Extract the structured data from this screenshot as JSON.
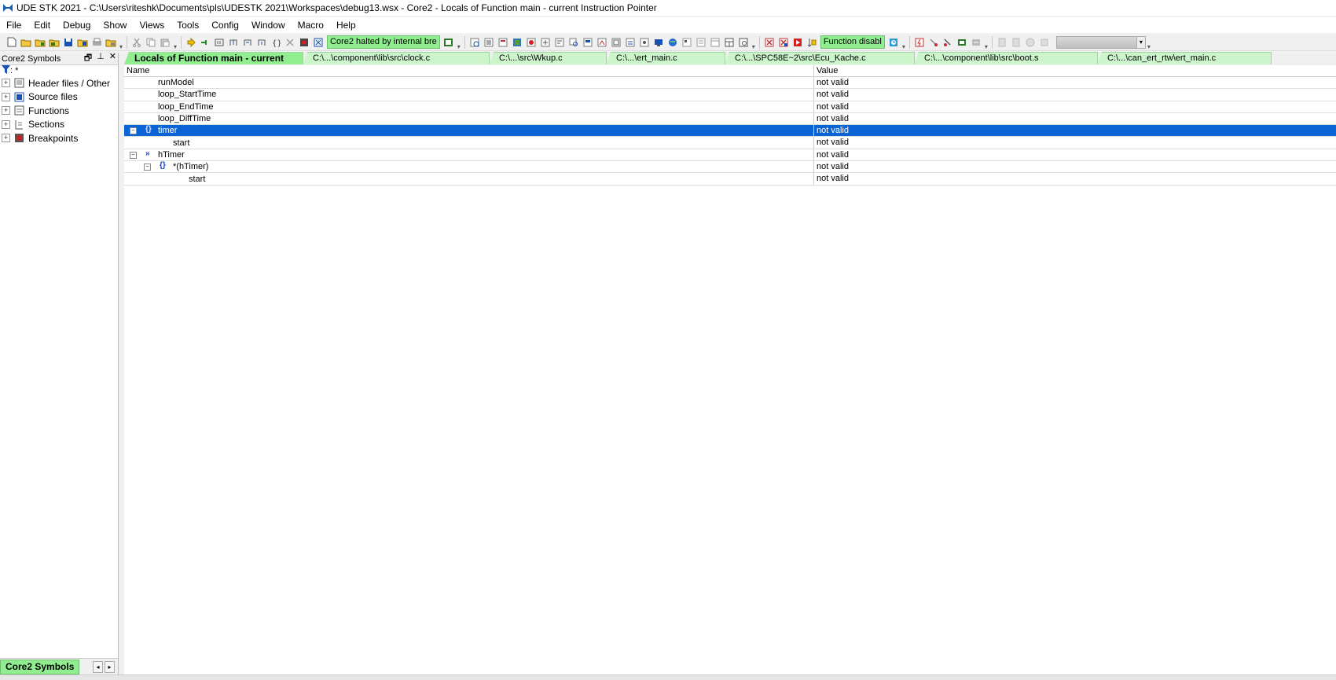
{
  "window": {
    "title": "UDE STK 2021 - C:\\Users\\riteshk\\Documents\\pls\\UDESTK 2021\\Workspaces\\debug13.wsx - Core2 - Locals of Function main - current Instruction Pointer"
  },
  "menu": [
    "File",
    "Edit",
    "Debug",
    "Show",
    "Views",
    "Tools",
    "Config",
    "Window",
    "Macro",
    "Help"
  ],
  "toolbar": {
    "core_status": "Core2 halted by internal bre",
    "function_status": "Function disabl"
  },
  "left_panel": {
    "title": "Core2 Symbols",
    "filter": ": *",
    "items": [
      {
        "label": "Header files / Other",
        "icon": "header-files-icon"
      },
      {
        "label": "Source files",
        "icon": "source-files-icon"
      },
      {
        "label": "Functions",
        "icon": "functions-icon"
      },
      {
        "label": "Sections",
        "icon": "sections-icon"
      },
      {
        "label": "Breakpoints",
        "icon": "breakpoints-icon"
      }
    ],
    "bottom_tab": "Core2 Symbols"
  },
  "tabs": [
    {
      "label": "Locals of Function main - current"
    },
    {
      "label": "C:\\...\\component\\lib\\src\\clock.c"
    },
    {
      "label": "C:\\...\\src\\Wkup.c"
    },
    {
      "label": "C:\\...\\ert_main.c"
    },
    {
      "label": "C:\\...\\SPC58E~2\\src\\Ecu_Kache.c"
    },
    {
      "label": "C:\\...\\component\\lib\\src\\boot.s"
    },
    {
      "label": "C:\\...\\can_ert_rtw\\ert_main.c"
    }
  ],
  "grid": {
    "headers": {
      "name": "Name",
      "value": "Value"
    },
    "rows": [
      {
        "name": "runModel",
        "value": "not valid"
      },
      {
        "name": "loop_StartTime",
        "value": "not valid"
      },
      {
        "name": "loop_EndTime",
        "value": "not valid"
      },
      {
        "name": "loop_DiffTime",
        "value": "not valid"
      },
      {
        "name": "timer",
        "value": "not valid",
        "icon": "{}"
      },
      {
        "name": "start",
        "value": "not valid"
      },
      {
        "name": "hTimer",
        "value": "not valid",
        "icon": "»"
      },
      {
        "name": "*(hTimer)",
        "value": "not valid",
        "icon": "{}"
      },
      {
        "name": "start",
        "value": "not valid"
      }
    ]
  }
}
